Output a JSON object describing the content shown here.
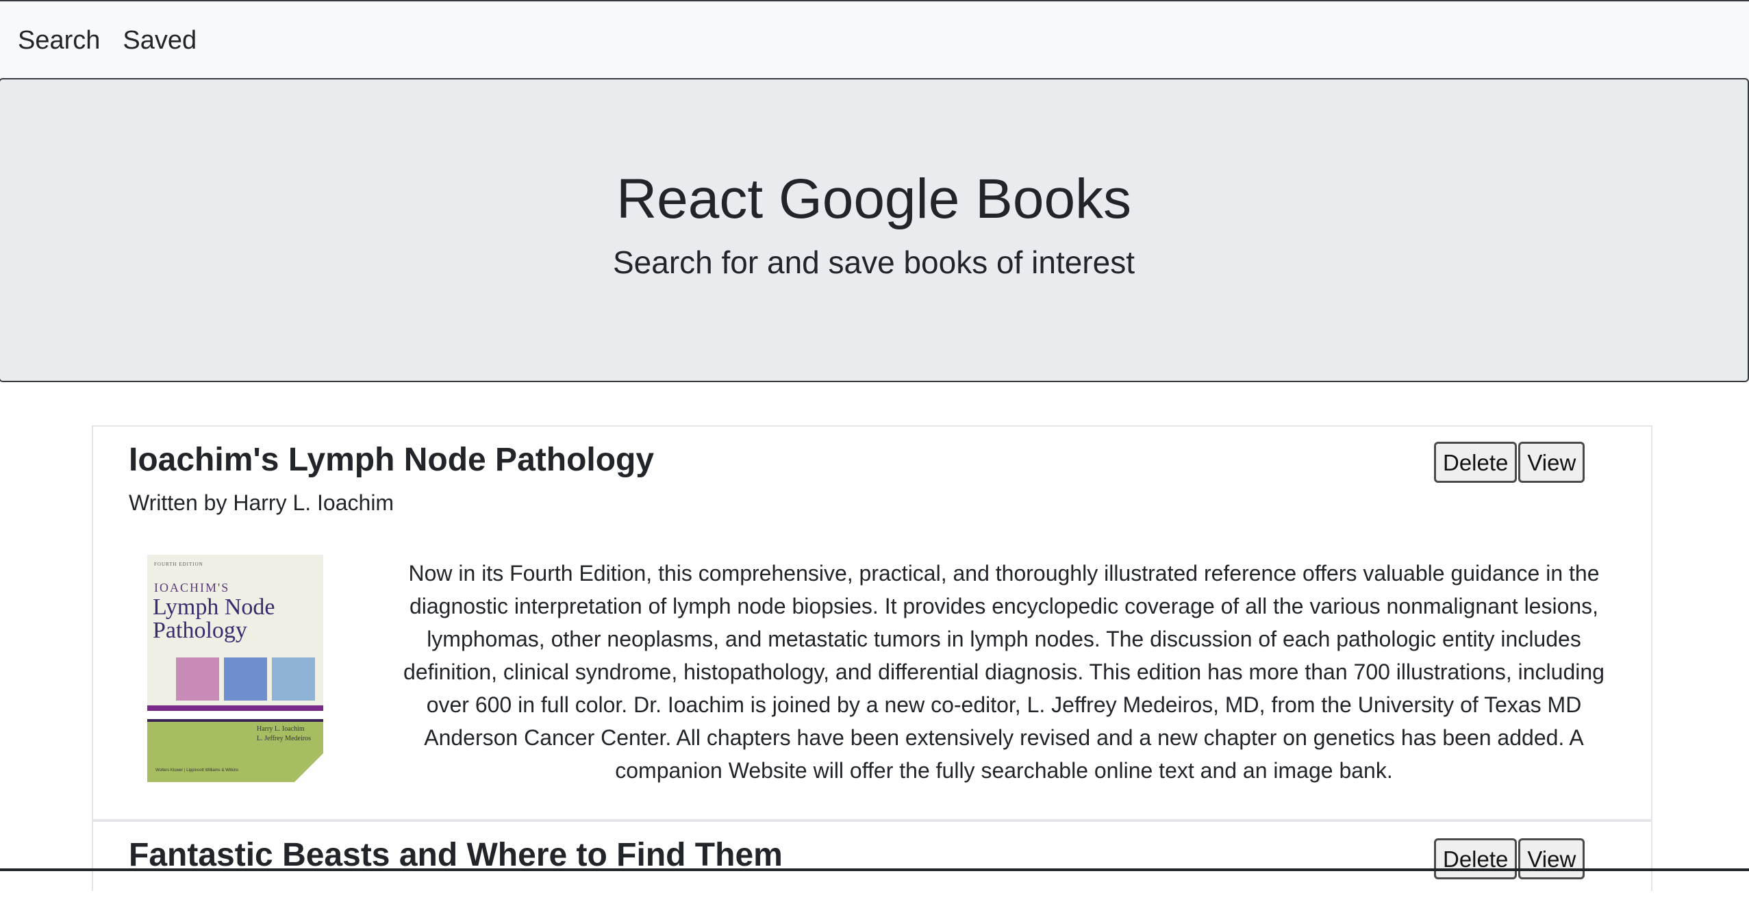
{
  "nav": {
    "links": [
      "Search",
      "Saved"
    ]
  },
  "jumbotron": {
    "title": "React Google Books",
    "subtitle": "Search for and save books of interest"
  },
  "books": [
    {
      "title": "Ioachim's Lymph Node Pathology",
      "author_line": "Written by Harry L. Ioachim",
      "delete_label": "Delete",
      "view_label": "View",
      "cover": {
        "edition": "FOURTH EDITION",
        "author_mark": "IOACHIM'S",
        "title_line1": "Lymph Node",
        "title_line2": "Pathology",
        "names_line1": "Harry L. Ioachim",
        "names_line2": "L. Jeffrey Medeiros",
        "publisher": "Wolters Kluwer | Lippincott Williams & Wilkins"
      },
      "description": "Now in its Fourth Edition, this comprehensive, practical, and thoroughly illustrated reference offers valuable guidance in the diagnostic interpretation of lymph node biopsies. It provides encyclopedic coverage of all the various nonmalignant lesions, lymphomas, other neoplasms, and metastatic tumors in lymph nodes. The discussion of each pathologic entity includes definition, clinical syndrome, histopathology, and differential diagnosis. This edition has more than 700 illustrations, including over 600 in full color. Dr. Ioachim is joined by a new co-editor, L. Jeffrey Medeiros, MD, from the University of Texas MD Anderson Cancer Center. All chapters have been extensively revised and a new chapter on genetics has been added. A companion Website will offer the fully searchable online text and an image bank."
    },
    {
      "title": "Fantastic Beasts and Where to Find Them",
      "delete_label": "Delete",
      "view_label": "View"
    }
  ],
  "colors": {
    "navbar_bg": "#f8f9fa",
    "jumbotron_bg": "#e9ecef",
    "text": "#212529",
    "border": "#343a40"
  }
}
